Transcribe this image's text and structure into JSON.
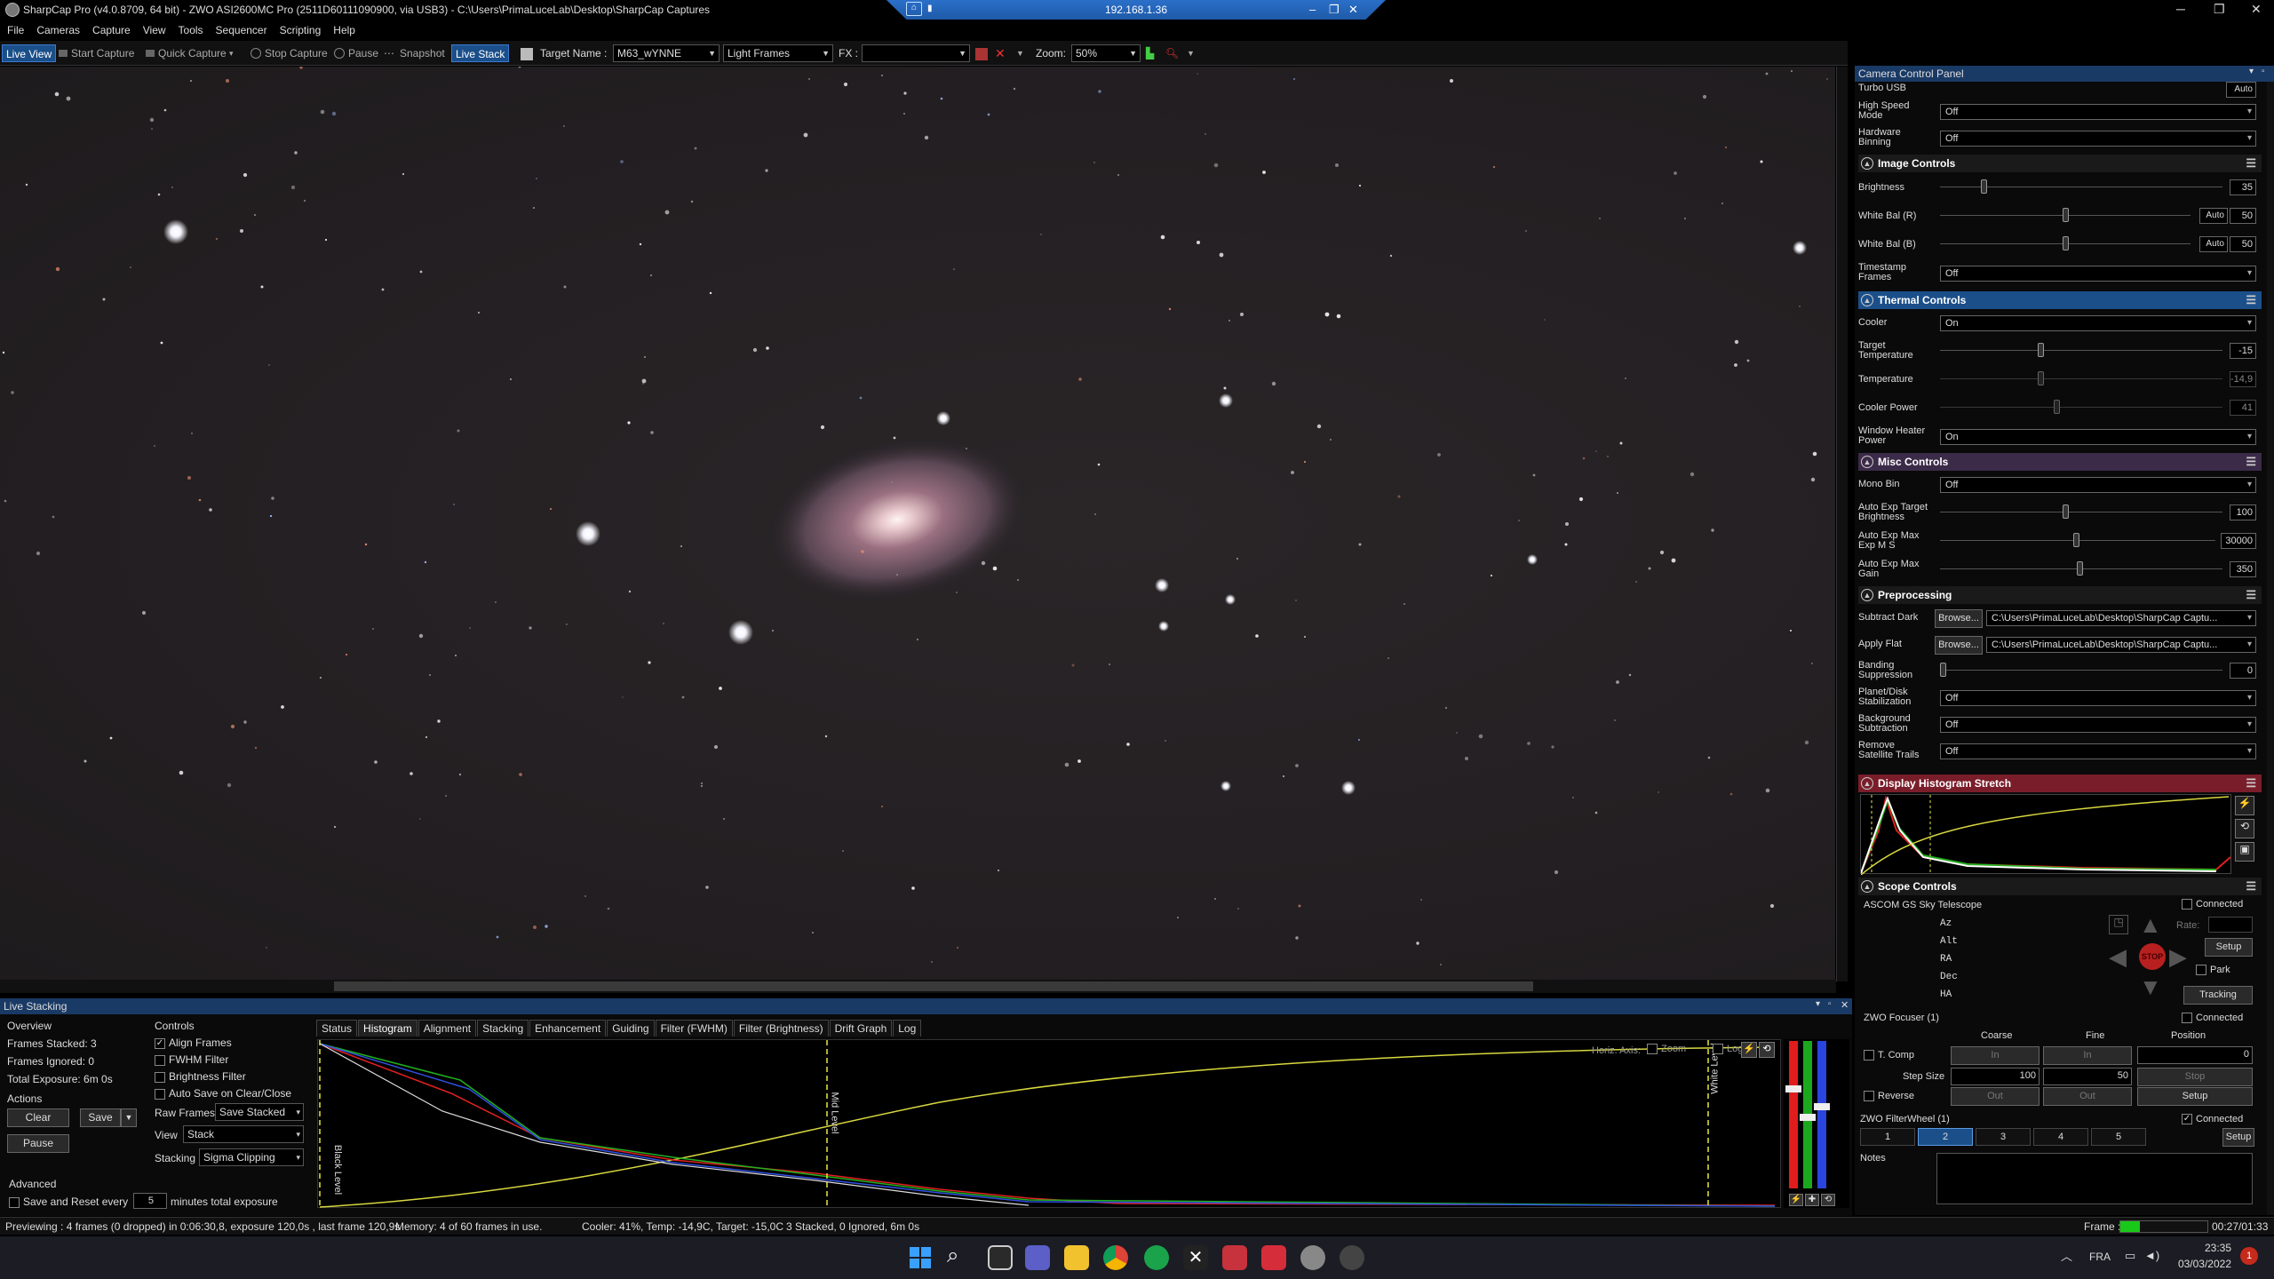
{
  "titlebar": {
    "title": "SharpCap Pro (v4.0.8709, 64 bit) - ZWO ASI2600MC Pro (2511D60111090900, via USB3) - C:\\Users\\PrimaLuceLab\\Desktop\\SharpCap Captures"
  },
  "remote": {
    "ip": "192.168.1.36"
  },
  "menu": [
    "File",
    "Cameras",
    "Capture",
    "View",
    "Tools",
    "Sequencer",
    "Scripting",
    "Help"
  ],
  "toolbar": {
    "live_view": "Live View",
    "start_capture": "Start Capture",
    "quick_capture": "Quick Capture",
    "stop_capture": "Stop Capture",
    "pause": "Pause",
    "snapshot": "Snapshot",
    "live_stack": "Live Stack",
    "target_label": "Target Name :",
    "target_value": "M63_wYNNE",
    "frame_type": "Light Frames",
    "fx_label": "FX :",
    "zoom_label": "Zoom:",
    "zoom_value": "50%"
  },
  "live_stacking": {
    "title": "Live Stacking",
    "overview": {
      "title": "Overview",
      "frames_stacked": "Frames Stacked: 3",
      "frames_ignored": "Frames Ignored: 0",
      "total_exposure": "Total Exposure:  6m 0s"
    },
    "actions": {
      "title": "Actions",
      "clear": "Clear",
      "save": "Save",
      "pause": "Pause"
    },
    "advanced": {
      "title": "Advanced",
      "save_reset": "Save and Reset every",
      "minutes_value": "5",
      "minutes_label": "minutes total exposure"
    },
    "controls": {
      "title": "Controls",
      "align": "Align Frames",
      "fwhm": "FWHM Filter",
      "brightness": "Brightness Filter",
      "autosave": "Auto Save on Clear/Close",
      "raw_frames_label": "Raw Frames",
      "raw_frames_value": "Save Stacked",
      "view_label": "View",
      "view_value": "Stack",
      "stacking_label": "Stacking",
      "stacking_value": "Sigma Clipping"
    },
    "tabs": [
      "Status",
      "Histogram",
      "Alignment",
      "Stacking",
      "Enhancement",
      "Guiding",
      "Filter (FWHM)",
      "Filter (Brightness)",
      "Drift Graph",
      "Log"
    ],
    "histogram": {
      "black_level": "Black Level",
      "mid_level": "Mid Level",
      "white_level": "White Level",
      "horiz_axis": "Horiz. Axis:",
      "zoom": "Zoom",
      "log": "Log"
    }
  },
  "status": {
    "preview": "Previewing : 4 frames (0 dropped) in 0:06:30,8, exposure 120,0s , last frame 120,9s",
    "memory": "Memory: 4 of 60 frames in use.",
    "cooler": "Cooler: 41%, Temp: -14,9C, Target: -15,0C",
    "stack": "3 Stacked, 0 Ignored, 6m 0s",
    "frame_label": "Frame :",
    "frame_time": "00:27/01:33"
  },
  "panel": {
    "title": "Camera Control Panel",
    "turbo_usb": "Turbo USB",
    "auto": "Auto",
    "high_speed_label": "High Speed Mode",
    "high_speed_value": "Off",
    "hw_bin_label": "Hardware Binning",
    "hw_bin_value": "Off",
    "image_controls": "Image Controls",
    "brightness_label": "Brightness",
    "brightness_value": "35",
    "wb_r_label": "White Bal (R)",
    "wb_r_value": "50",
    "wb_b_label": "White Bal (B)",
    "wb_b_value": "50",
    "timestamp_label": "Timestamp Frames",
    "timestamp_value": "Off",
    "thermal_controls": "Thermal Controls",
    "cooler_label": "Cooler",
    "cooler_value": "On",
    "target_temp_label": "Target Temperature",
    "target_temp_value": "-15",
    "temp_label": "Temperature",
    "temp_value": "-14,9",
    "cooler_power_label": "Cooler Power",
    "cooler_power_value": "41",
    "window_heater_label": "Window Heater Power",
    "window_heater_value": "On",
    "misc_controls": "Misc Controls",
    "mono_bin_label": "Mono Bin",
    "mono_bin_value": "Off",
    "ae_target_label": "Auto Exp Target Brightness",
    "ae_target_value": "100",
    "ae_max_exp_label": "Auto Exp Max Exp M S",
    "ae_max_exp_value": "30000",
    "ae_max_gain_label": "Auto Exp Max Gain",
    "ae_max_gain_value": "350",
    "preprocessing": "Preprocessing",
    "subtract_dark_label": "Subtract Dark",
    "browse": "Browse...",
    "dark_path": "C:\\Users\\PrimaLuceLab\\Desktop\\SharpCap Captu...",
    "apply_flat_label": "Apply Flat",
    "flat_path": "C:\\Users\\PrimaLuceLab\\Desktop\\SharpCap Captu...",
    "banding_label": "Banding Suppression",
    "banding_value": "0",
    "planet_label": "Planet/Disk Stabilization",
    "planet_value": "Off",
    "bg_sub_label": "Background Subtraction",
    "bg_sub_value": "Off",
    "sat_label": "Remove Satellite Trails",
    "sat_value": "Off",
    "display_histogram": "Display Histogram Stretch",
    "scope_controls": "Scope Controls",
    "scope_name": "ASCOM GS Sky Telescope",
    "connected": "Connected",
    "az": "Az",
    "alt": "Alt",
    "ra": "RA",
    "dec": "Dec",
    "ha": "HA",
    "rate": "Rate:",
    "setup": "Setup",
    "park": "Park",
    "tracking": "Tracking",
    "stop": "STOP",
    "focuser_title": "ZWO Focuser (1)",
    "coarse": "Coarse",
    "fine": "Fine",
    "position": "Position",
    "tcomp": "T. Comp",
    "in": "In",
    "position_value": "0",
    "step_size": "Step Size",
    "step_coarse": "100",
    "step_fine": "50",
    "stop_btn": "Stop",
    "reverse": "Reverse",
    "out": "Out",
    "filterwheel_title": "ZWO FilterWheel (1)",
    "filters": [
      "1",
      "2",
      "3",
      "4",
      "5"
    ],
    "notes": "Notes"
  },
  "taskbar": {
    "lang": "FRA",
    "time": "23:35",
    "date": "03/03/2022",
    "badge": "1"
  }
}
